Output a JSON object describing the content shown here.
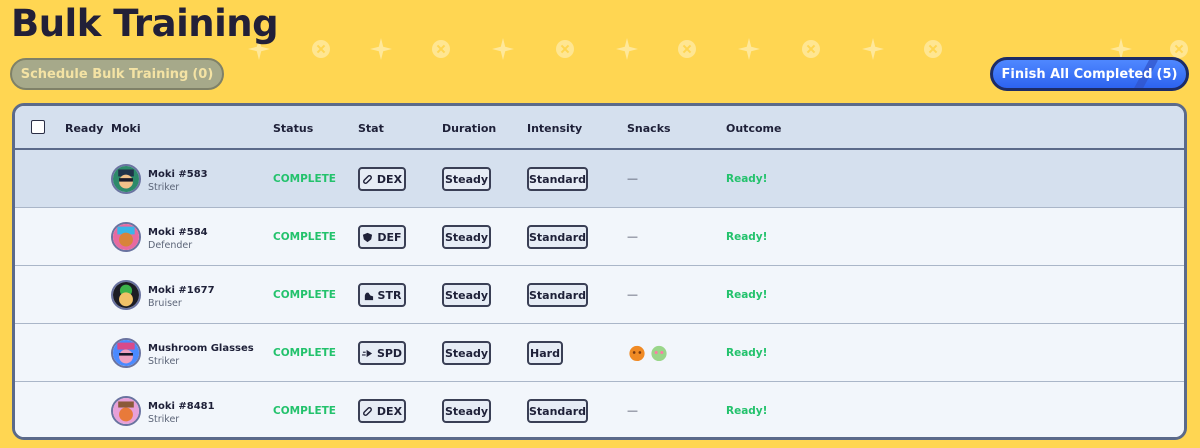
{
  "page": {
    "title": "Bulk Training"
  },
  "actions": {
    "schedule_label": "Schedule Bulk Training",
    "schedule_count": "(0)",
    "finish_label": "Finish All Completed",
    "finish_count": "(5)"
  },
  "table": {
    "headers": {
      "ready": "Ready",
      "moki": "Moki",
      "status": "Status",
      "stat": "Stat",
      "duration": "Duration",
      "intensity": "Intensity",
      "snacks": "Snacks",
      "outcome": "Outcome"
    },
    "rows": [
      {
        "name": "Moki #583",
        "class": "Striker",
        "status": "COMPLETE",
        "stat": "DEX",
        "stat_icon": "bandage-icon",
        "duration": "Steady",
        "intensity": "Standard",
        "snacks": "—",
        "outcome": "Ready!"
      },
      {
        "name": "Moki #584",
        "class": "Defender",
        "status": "COMPLETE",
        "stat": "DEF",
        "stat_icon": "shield-icon",
        "duration": "Steady",
        "intensity": "Standard",
        "snacks": "—",
        "outcome": "Ready!"
      },
      {
        "name": "Moki #1677",
        "class": "Bruiser",
        "status": "COMPLETE",
        "stat": "STR",
        "stat_icon": "flexed-arm-icon",
        "duration": "Steady",
        "intensity": "Standard",
        "snacks": "—",
        "outcome": "Ready!"
      },
      {
        "name": "Mushroom Glasses",
        "class": "Striker",
        "status": "COMPLETE",
        "stat": "SPD",
        "stat_icon": "speed-icon",
        "duration": "Steady",
        "intensity": "Hard",
        "snacks": "",
        "snack_icons": [
          "orange-snack-icon",
          "green-snack-icon"
        ],
        "outcome": "Ready!"
      },
      {
        "name": "Moki #8481",
        "class": "Striker",
        "status": "COMPLETE",
        "stat": "DEX",
        "stat_icon": "bandage-icon",
        "duration": "Steady",
        "intensity": "Standard",
        "snacks": "—",
        "outcome": "Ready!"
      }
    ]
  },
  "colors": {
    "background": "#ffd652",
    "status_green": "#23c26c",
    "finish_blue": "#2d63f0",
    "row_selected": "#d5e0ee"
  }
}
